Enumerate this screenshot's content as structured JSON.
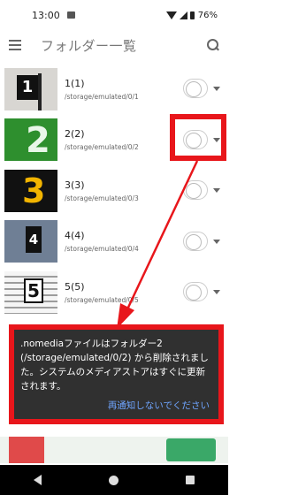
{
  "status_bar": {
    "time": "13:00",
    "battery": "76%"
  },
  "app_bar": {
    "title": "フォルダー一覧"
  },
  "folders": [
    {
      "name": "1(1)",
      "path": "/storage/emulated/0/1"
    },
    {
      "name": "2(2)",
      "path": "/storage/emulated/0/2"
    },
    {
      "name": "3(3)",
      "path": "/storage/emulated/0/3"
    },
    {
      "name": "4(4)",
      "path": "/storage/emulated/0/4"
    },
    {
      "name": "5(5)",
      "path": "/storage/emulated/0/5"
    }
  ],
  "thumbnails": {
    "t1": "1",
    "t2": "2",
    "t3": "3",
    "t4": "4",
    "t5": "5"
  },
  "snackbar": {
    "message": ".nomediaファイルはフォルダー2 (/storage/emulated/0/2) から削除されました。システムのメディアストアはすぐに更新されます。",
    "action": "再通知しないでください"
  },
  "colors": {
    "highlight": "#e8161b",
    "snackbar_bg": "#303030",
    "action": "#6fa5ff"
  }
}
